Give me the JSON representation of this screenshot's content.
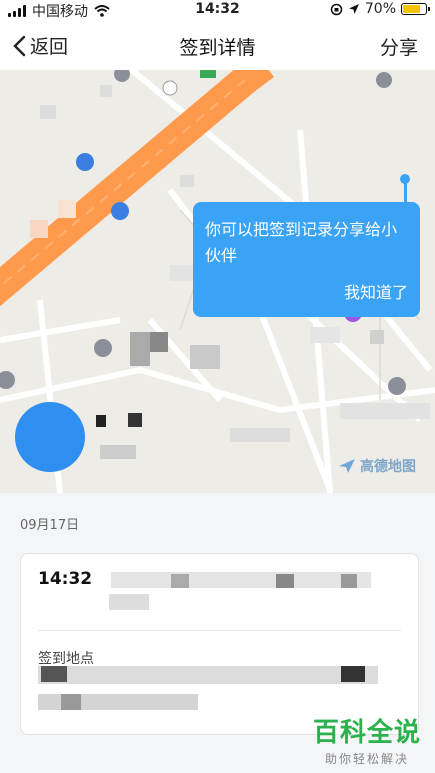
{
  "status_bar": {
    "carrier": "中国移动",
    "time": "14:32",
    "battery": "70%",
    "battery_level": 0.7
  },
  "nav": {
    "back_label": "返回",
    "title": "签到详情",
    "share_label": "分享"
  },
  "map": {
    "provider_label": "高德地图"
  },
  "tooltip": {
    "message": "你可以把签到记录分享给小伙伴",
    "dismiss_label": "我知道了"
  },
  "record_list": {
    "date": "09月17日",
    "items": [
      {
        "time": "14:32",
        "location_label": "签到地点"
      }
    ]
  },
  "watermark": {
    "title": "百科全说",
    "subtitle": "助你轻松解决"
  },
  "colors": {
    "accent": "#3aa3f5",
    "road": "#ff9a4d",
    "avatar": "#2f8ff0",
    "watermark": "#2bb24c"
  }
}
